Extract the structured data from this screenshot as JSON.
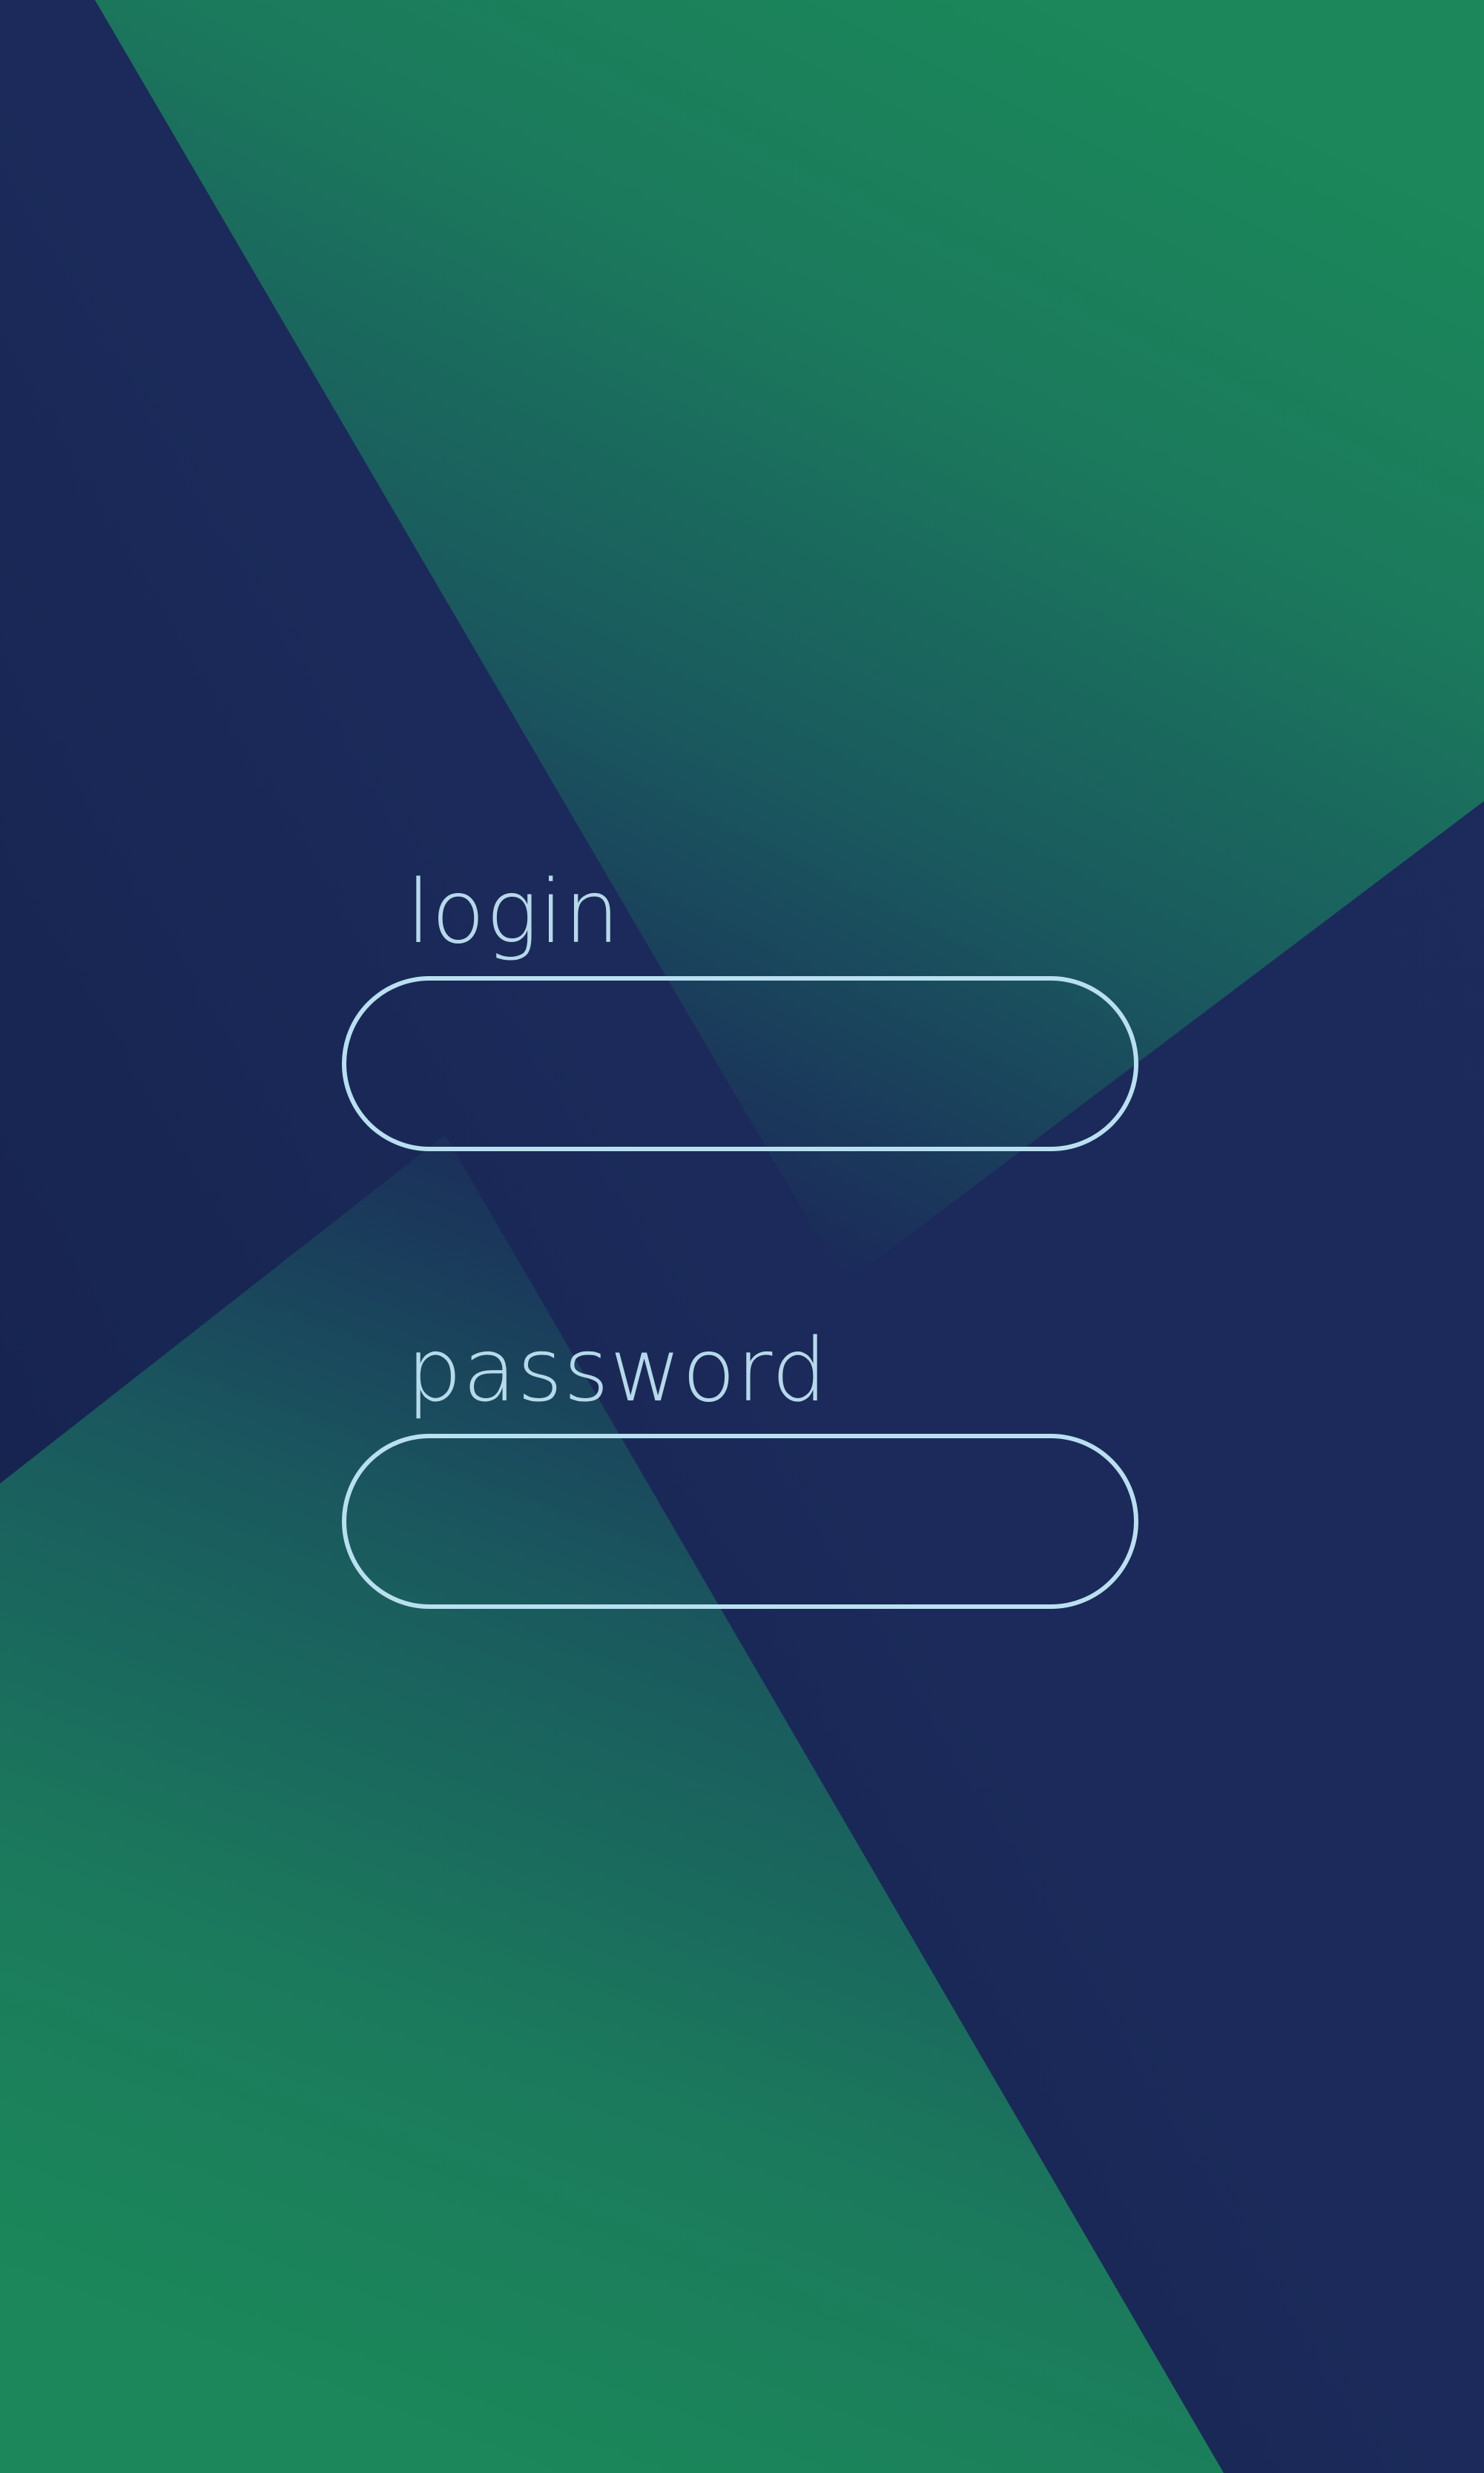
{
  "login": {
    "label": "login",
    "value": "",
    "placeholder": ""
  },
  "password": {
    "label": "password",
    "value": "",
    "placeholder": ""
  },
  "colors": {
    "background_navy": "#1b2a5a",
    "accent_green": "#1b875a",
    "field_outline": "#b9e0f0",
    "label_text": "#bfe3f2"
  }
}
